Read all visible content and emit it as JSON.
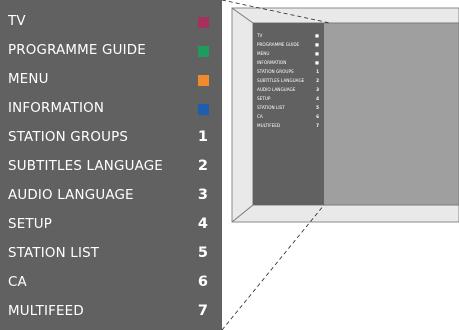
{
  "menu": {
    "items": [
      {
        "label": "TV",
        "marker": "",
        "swatch": "#a8305c"
      },
      {
        "label": "PROGRAMME GUIDE",
        "marker": "",
        "swatch": "#1f9b5b"
      },
      {
        "label": "MENU",
        "marker": "",
        "swatch": "#f08a2a"
      },
      {
        "label": "INFORMATION",
        "marker": "",
        "swatch": "#1f5db0"
      },
      {
        "label": "STATION GROUPS",
        "marker": "1",
        "swatch": ""
      },
      {
        "label": "SUBTITLES LANGUAGE",
        "marker": "2",
        "swatch": ""
      },
      {
        "label": "AUDIO LANGUAGE",
        "marker": "3",
        "swatch": ""
      },
      {
        "label": "SETUP",
        "marker": "4",
        "swatch": ""
      },
      {
        "label": "STATION LIST",
        "marker": "5",
        "swatch": ""
      },
      {
        "label": "CA",
        "marker": "6",
        "swatch": ""
      },
      {
        "label": "MULTIFEED",
        "marker": "7",
        "swatch": ""
      }
    ]
  },
  "tv_thumbnail": {
    "items": [
      {
        "label": "TV",
        "value": "■"
      },
      {
        "label": "PROGRAMME GUIDE",
        "value": "■"
      },
      {
        "label": "MENU",
        "value": "■"
      },
      {
        "label": "INFORMATION",
        "value": "■"
      },
      {
        "label": "STATION GROUPS",
        "value": "1"
      },
      {
        "label": "SUBTITLES LANGUAGE",
        "value": "2"
      },
      {
        "label": "AUDIO LANGUAGE",
        "value": "3"
      },
      {
        "label": "SETUP",
        "value": "4"
      },
      {
        "label": "STATION LIST",
        "value": "5"
      },
      {
        "label": "CA",
        "value": "6"
      },
      {
        "label": "MULTIFEED",
        "value": "7"
      }
    ]
  }
}
